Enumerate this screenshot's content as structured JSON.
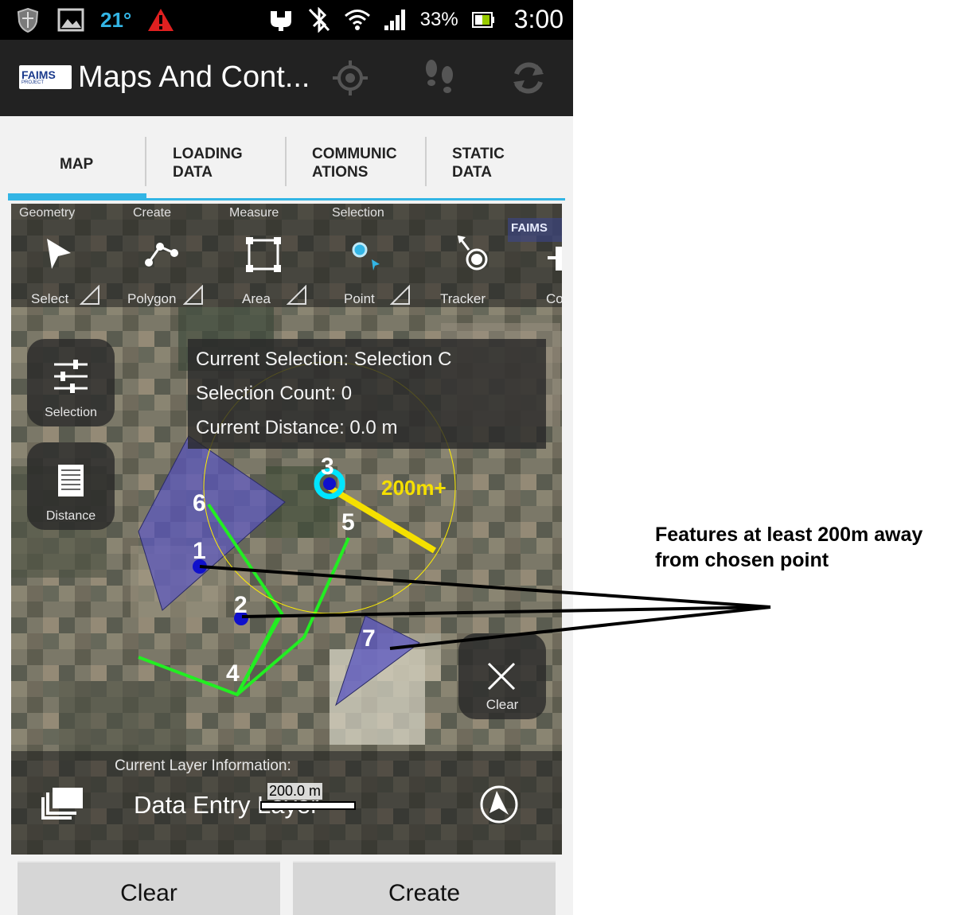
{
  "status_bar": {
    "temperature": "21°",
    "battery": "33%",
    "time": "3:00",
    "icons": [
      "shield-icon",
      "image-icon",
      "warning-icon",
      "usb-icon",
      "bluetooth-off-icon",
      "wifi-icon",
      "signal-icon",
      "battery-icon"
    ]
  },
  "action_bar": {
    "logo_text": "FAIMS",
    "logo_sub": "PROJECT",
    "title": "Maps And Cont...",
    "buttons": [
      "gps-target-icon",
      "footsteps-icon",
      "sync-icon"
    ]
  },
  "tabs": [
    {
      "label": "MAP",
      "active": true
    },
    {
      "label": "LOADING DATA",
      "active": false
    },
    {
      "label": "COMMUNIC ATIONS",
      "active": false
    },
    {
      "label": "STATIC DATA",
      "active": false
    }
  ],
  "toolbar": {
    "headers": [
      "Geometry",
      "Create",
      "Measure",
      "Selection"
    ],
    "tools": [
      {
        "label": "Select",
        "icon": "pointer-icon"
      },
      {
        "label": "Polygon",
        "icon": "polygon-icon"
      },
      {
        "label": "Area",
        "icon": "area-icon"
      },
      {
        "label": "Point",
        "icon": "point-icon"
      },
      {
        "label": "Tracker",
        "icon": "tracker-icon"
      },
      {
        "label": "Co",
        "icon": "config-icon"
      }
    ],
    "watermark": "FAIMS"
  },
  "side_buttons": {
    "selection_label": "Selection",
    "distance_label": "Distance"
  },
  "info_panel": {
    "current_selection": "Current Selection: Selection C",
    "selection_count": "Selection Count: 0",
    "current_distance": "Current Distance: 0.0 m"
  },
  "map": {
    "radius_label": "200m+",
    "feature_numbers": [
      "1",
      "2",
      "3",
      "4",
      "5",
      "6",
      "7"
    ],
    "clear_label": "Clear",
    "colors": {
      "polygon": "#5050b4",
      "line": "#22ee22",
      "point": "#1010cc",
      "circle": "#ffee00",
      "radius": "#f5e000",
      "chosen": "#00e5ff"
    }
  },
  "layer_info": {
    "heading": "Current Layer Information:",
    "name": "Data Entry Layer",
    "scale": "200.0 m"
  },
  "buttons": {
    "clear": "Clear",
    "create": "Create"
  },
  "annotation": {
    "line1": "Features at least 200m away",
    "line2": "from chosen point"
  }
}
